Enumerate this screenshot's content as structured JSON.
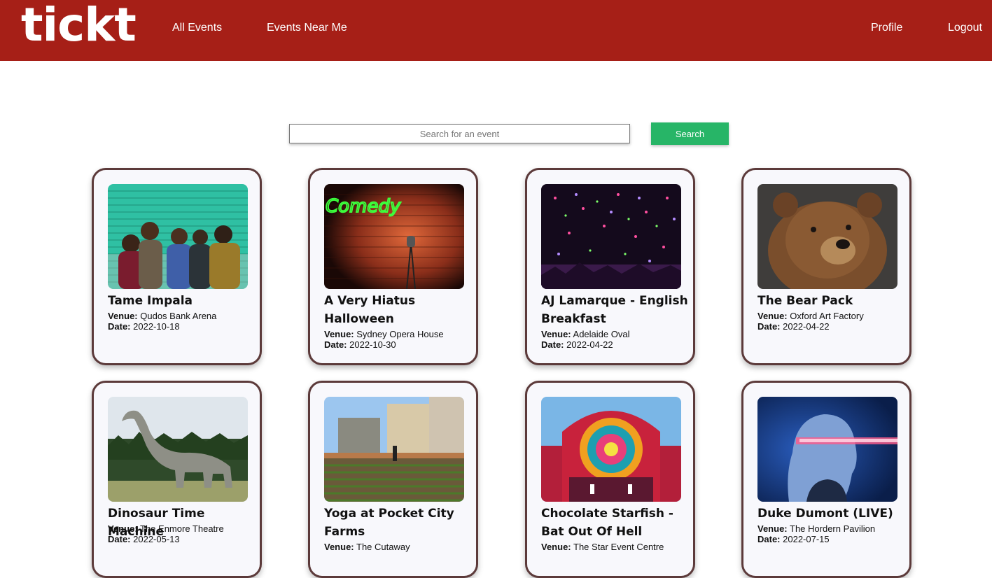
{
  "nav": {
    "logo": "tickt",
    "all_events": "All Events",
    "events_near_me": "Events Near Me",
    "profile": "Profile",
    "logout": "Logout"
  },
  "search": {
    "placeholder": "Search for an event",
    "button_label": "Search"
  },
  "meta_labels": {
    "venue": "Venue:",
    "date": "Date:"
  },
  "events": [
    {
      "title": "Tame Impala",
      "venue": "Qudos Bank Arena",
      "date": "2022-10-18",
      "image": "band-photo"
    },
    {
      "title": "A Very Hiatus Halloween",
      "venue": "Sydney Opera House",
      "date": "2022-10-30",
      "image": "comedy-neon-brick-wall"
    },
    {
      "title": "AJ Lamarque - English Breakfast",
      "venue": "Adelaide Oval",
      "date": "2022-04-22",
      "image": "confetti-crowd"
    },
    {
      "title": "The Bear Pack",
      "venue": "Oxford Art Factory",
      "date": "2022-04-22",
      "image": "brown-bear"
    },
    {
      "title": "Dinosaur Time Machine",
      "venue": "The Enmore Theatre",
      "date": "2022-05-13",
      "image": "dinosaur-statue"
    },
    {
      "title": "Yoga at Pocket City Farms",
      "venue": "The Cutaway",
      "date": "",
      "image": "urban-farm"
    },
    {
      "title": "Chocolate Starfish - Bat Out Of Hell",
      "venue": "The Star Event Centre",
      "date": "",
      "image": "festival-stage"
    },
    {
      "title": "Duke Dumont (LIVE)",
      "venue": "The Hordern Pavilion",
      "date": "2022-07-15",
      "image": "dj-portrait"
    }
  ],
  "colors": {
    "navbar": "#a61f17",
    "search_button": "#27b567",
    "card_border": "#5c3a3a",
    "card_bg": "#f8f8fc"
  }
}
